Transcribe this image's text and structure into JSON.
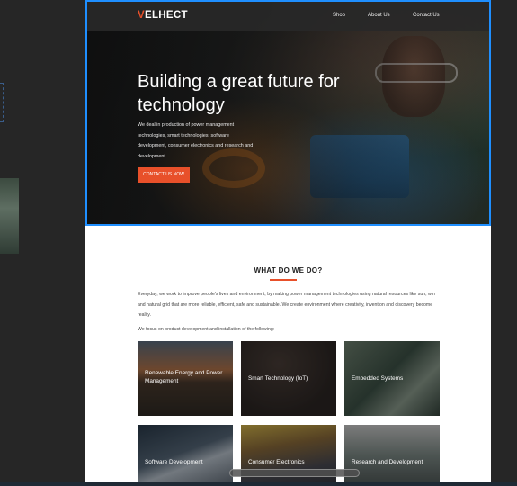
{
  "nav": {
    "logo_prefix": "V",
    "logo_rest": "ELHECT",
    "shop": "Shop",
    "about": "About Us",
    "contact": "Contact Us"
  },
  "hero": {
    "title": "Building a great future for technology",
    "text": "We deal in production of power management technologies, smart technologies, software development, consumer electronics and research and development.",
    "cta": "CONTACT US NOW"
  },
  "section": {
    "title": "WHAT DO WE DO?",
    "intro": "Everyday, we work to improve people's lives and environment, by making power management technologies using natural resources like sun, win and natural grid that are more reliable, efficient, safe and sustainable. We create environment where creativity, invention and discovery become reality.",
    "focus": "We focus on product development and installation of the following:"
  },
  "cards": [
    "Renewable Energy and Power Management",
    "Smart Technology (IoT)",
    "Embedded Systems",
    "Software Development",
    "Consumer Electronics",
    "Research and Development"
  ],
  "colors": {
    "accent": "#e8502a",
    "selection": "#1f8fff",
    "nav_bg": "#282828",
    "editor_bg": "#262626"
  }
}
